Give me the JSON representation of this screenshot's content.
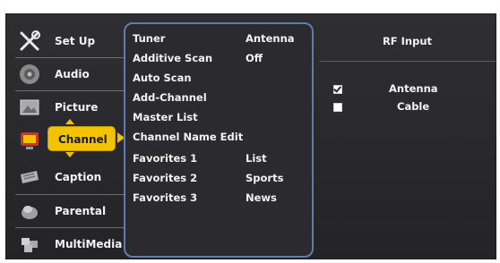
{
  "nav": {
    "items": [
      {
        "label": "Set Up",
        "icon": "tools-icon"
      },
      {
        "label": "Audio",
        "icon": "speaker-icon"
      },
      {
        "label": "Picture",
        "icon": "picture-icon"
      },
      {
        "label": "Channel",
        "icon": "tv-icon",
        "selected": true
      },
      {
        "label": "Caption",
        "icon": "caption-icon"
      },
      {
        "label": "Parental",
        "icon": "lock-icon"
      },
      {
        "label": "MultiMedia",
        "icon": "multimedia-icon"
      }
    ]
  },
  "channel_menu": {
    "items": [
      {
        "label": "Tuner",
        "value": "Antenna"
      },
      {
        "label": "Additive Scan",
        "value": "Off"
      },
      {
        "label": "Auto Scan",
        "value": ""
      },
      {
        "label": "Add-Channel",
        "value": ""
      },
      {
        "label": "Master List",
        "value": ""
      },
      {
        "label": "Channel Name Edit",
        "value": ""
      },
      {
        "label": "Favorites 1",
        "value": "List"
      },
      {
        "label": "Favorites 2",
        "value": "Sports"
      },
      {
        "label": "Favorites 3",
        "value": "News"
      }
    ]
  },
  "rf_input": {
    "title": "RF Input",
    "options": [
      {
        "label": "Antenna",
        "checked": true
      },
      {
        "label": "Cable",
        "checked": false
      }
    ]
  },
  "colors": {
    "accent": "#f3c300",
    "panel_border": "#5b7fa8",
    "background": "#2b2b2f"
  }
}
